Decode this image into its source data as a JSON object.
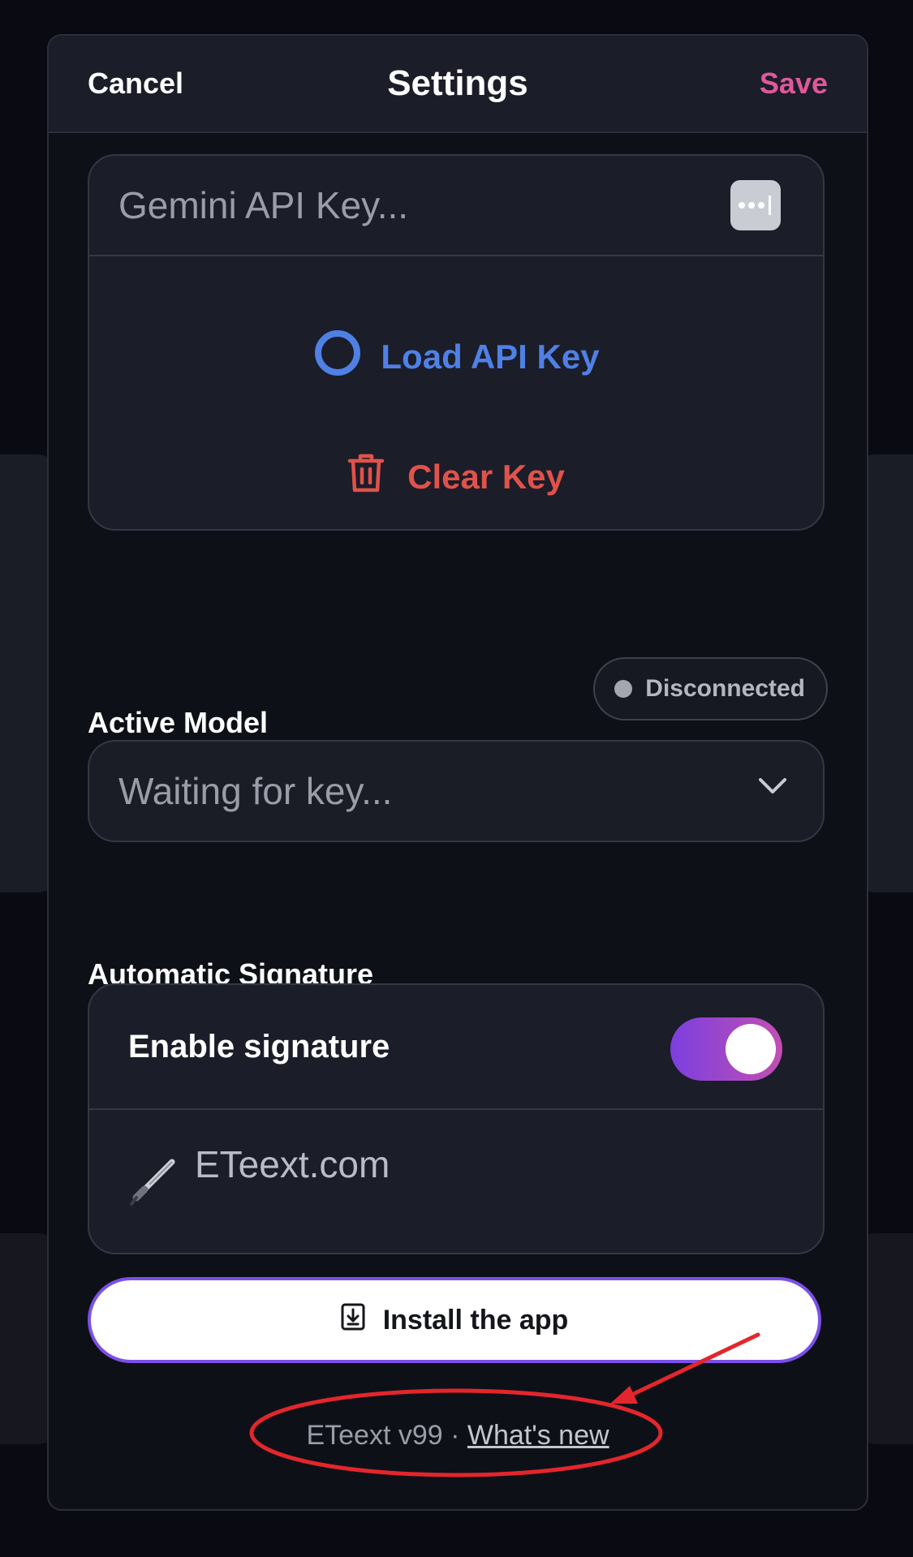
{
  "header": {
    "cancel_label": "Cancel",
    "title": "Settings",
    "save_label": "Save"
  },
  "api_key": {
    "placeholder": "Gemini API Key...",
    "password_icon": "password-dots-icon",
    "load_label": "Load API Key",
    "load_icon": "circle-icon",
    "clear_label": "Clear Key",
    "clear_icon": "trash-icon"
  },
  "model": {
    "section_label": "Active Model",
    "status_label": "Disconnected",
    "select_value": "Waiting for key...",
    "chevron_icon": "chevron-down-icon"
  },
  "signature": {
    "section_label": "Automatic Signature",
    "enable_label": "Enable signature",
    "enabled": true,
    "text_value": "ETeext.com",
    "icon": "pen-icon"
  },
  "install": {
    "label": "Install the app",
    "icon": "download-icon"
  },
  "footer": {
    "version_text": "ETeext v99 · ",
    "whats_new_label": "What's new"
  },
  "colors": {
    "accent_save": "#e0589b",
    "accent_load": "#4f80e6",
    "accent_clear": "#e0524b",
    "toggle_gradient_start": "#7c3fe0",
    "toggle_gradient_end": "#c24fb2",
    "annotation": "#e3262c"
  }
}
